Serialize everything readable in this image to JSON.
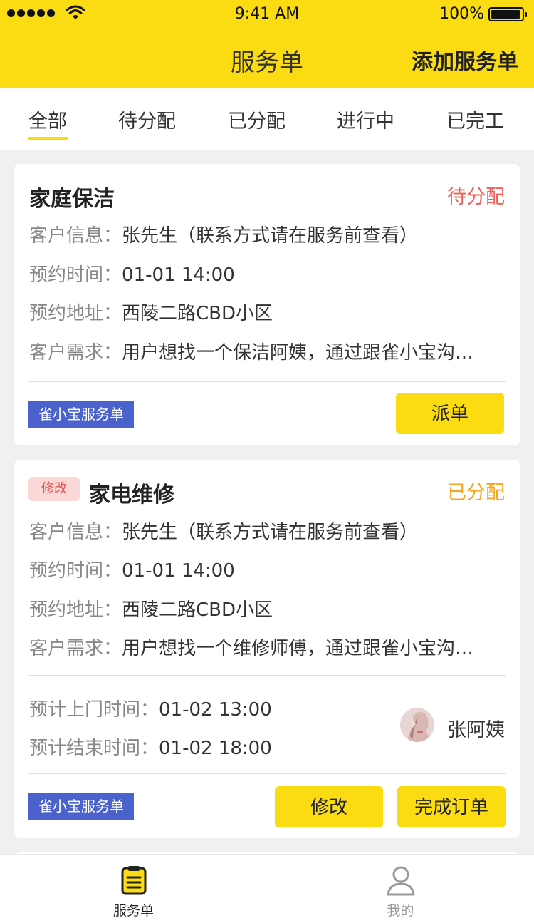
{
  "status_bar": {
    "time": "9:41 AM",
    "battery": "100%"
  },
  "nav": {
    "title": "服务单",
    "action": "添加服务单"
  },
  "tabs": [
    "全部",
    "待分配",
    "已分配",
    "进行中",
    "已完工"
  ],
  "orders": [
    {
      "title": "家庭保洁",
      "status": "待分配",
      "status_color": "#f0605a",
      "rows": [
        {
          "label": "客户信息：",
          "value": "张先生（联系方式请在服务前查看）"
        },
        {
          "label": "预约时间：",
          "value": "01-01 14:00"
        },
        {
          "label": "预约地址：",
          "value": "西陵二路CBD小区"
        },
        {
          "label": "客户需求：",
          "value": "用户想找一个保洁阿姨，通过跟雀小宝沟…"
        }
      ],
      "badge": "雀小宝服务单",
      "button": "派单"
    },
    {
      "tag": "修改",
      "title": "家电维修",
      "status": "已分配",
      "status_color": "#f5a623",
      "rows": [
        {
          "label": "客户信息：",
          "value": "张先生（联系方式请在服务前查看）"
        },
        {
          "label": "预约时间：",
          "value": "01-01 14:00"
        },
        {
          "label": "预约地址：",
          "value": "西陵二路CBD小区"
        },
        {
          "label": "客户需求：",
          "value": "用户想找一个维修师傅，通过跟雀小宝沟…"
        }
      ],
      "schedule": [
        {
          "label": "预计上门时间：",
          "value": "01-02 13:00"
        },
        {
          "label": "预计结束时间：",
          "value": "01-02 18:00"
        }
      ],
      "worker": "张阿姨",
      "badge": "雀小宝服务单",
      "buttons": [
        "修改",
        "完成订单"
      ]
    }
  ],
  "tabbar": [
    {
      "label": "服务单",
      "icon": "clipboard-icon",
      "active": true
    },
    {
      "label": "我的",
      "icon": "user-icon",
      "active": false
    }
  ],
  "colors": {
    "brand": "#fbdc12",
    "badge": "#4b61cc",
    "pending": "#f0605a",
    "assigned": "#f5a623"
  }
}
